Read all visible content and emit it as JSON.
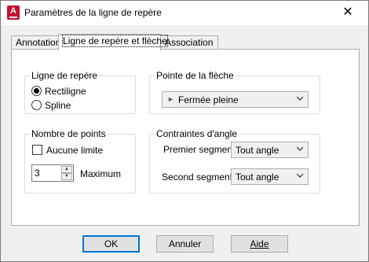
{
  "window": {
    "title": "Paramètres de la ligne de repère",
    "app_icon_letter": "A",
    "close_glyph": "✕"
  },
  "tabs": [
    {
      "label": "Annotation",
      "active": false
    },
    {
      "label": "Ligne de repère et flèche",
      "active": true
    },
    {
      "label": "Association",
      "active": false
    }
  ],
  "leader_line": {
    "title": "Ligne de repère",
    "options": [
      {
        "label": "Rectiligne",
        "checked": true
      },
      {
        "label": "Spline",
        "checked": false
      }
    ]
  },
  "arrowhead": {
    "title": "Pointe de la flèche",
    "selected": "Fermée pleine",
    "marker_glyph": "►"
  },
  "num_points": {
    "title": "Nombre de points",
    "no_limit_label": "Aucune limite",
    "no_limit_checked": false,
    "value": "3",
    "max_label": "Maximum"
  },
  "angle_constraints": {
    "title": "Contraintes d'angle",
    "first_label": "Premier segment:",
    "first_value": "Tout angle",
    "second_label": "Second segment:",
    "second_value": "Tout angle"
  },
  "buttons": {
    "ok": "OK",
    "cancel": "Annuler",
    "help": "Aide"
  },
  "colors": {
    "accent": "#0078d7",
    "app_icon": "#c8102e"
  }
}
